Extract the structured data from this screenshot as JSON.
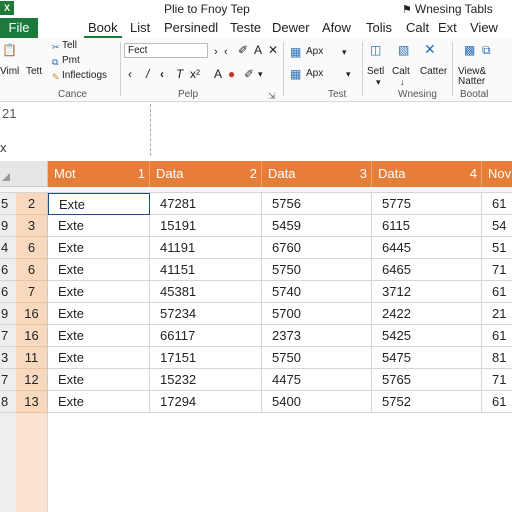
{
  "app": {
    "logo_text": "X",
    "title": "Plie to Fnoy Tep",
    "right_title": "Wnesing Tabls",
    "right_title_icon": "bell-icon"
  },
  "tabs": [
    "File",
    "Book",
    "List",
    "Persinedl",
    "Teste",
    "Dewer",
    "Afow",
    "Tolis",
    "Calt",
    "Ext",
    "View"
  ],
  "ribbon": {
    "clip_items": [
      "Tell",
      "Pmt",
      "Inflectiogs"
    ],
    "left_items": [
      "Viml",
      "Tett"
    ],
    "font_name": "Fect",
    "groups": [
      "Cance",
      "Pelp",
      "Test",
      "Wnesing",
      "Bootal"
    ],
    "style_labels": [
      "Apx",
      "Apx"
    ],
    "right_labels": [
      "Setl",
      "Calt",
      "Catter",
      "View&",
      "Natter"
    ]
  },
  "namebox": "21",
  "formula_prefix": "x",
  "columns": [
    {
      "num": "",
      "label": "Mot"
    },
    {
      "num": "1",
      "label": "Data"
    },
    {
      "num": "2",
      "label": "Data"
    },
    {
      "num": "3",
      "label": "Data"
    },
    {
      "num": "4",
      "label": "Nov"
    }
  ],
  "rows": [
    {
      "a": "5",
      "b": "2",
      "cells": [
        "Exte",
        "47281",
        "5756",
        "5775",
        "61"
      ]
    },
    {
      "a": "9",
      "b": "3",
      "cells": [
        "Exte",
        "15191",
        "5459",
        "6115",
        "54"
      ]
    },
    {
      "a": "4",
      "b": "6",
      "cells": [
        "Exte",
        "41191",
        "6760",
        "6445",
        "51"
      ]
    },
    {
      "a": "6",
      "b": "6",
      "cells": [
        "Exte",
        "41151",
        "5750",
        "6465",
        "71"
      ]
    },
    {
      "a": "6",
      "b": "7",
      "cells": [
        "Exte",
        "45381",
        "5740",
        "3712",
        "61"
      ]
    },
    {
      "a": "9",
      "b": "16",
      "cells": [
        "Exte",
        "57234",
        "5700",
        "2422",
        "21"
      ]
    },
    {
      "a": "7",
      "b": "16",
      "cells": [
        "Exte",
        "66117",
        "2373",
        "5425",
        "61"
      ]
    },
    {
      "a": "3",
      "b": "11",
      "cells": [
        "Exte",
        "17151",
        "5750",
        "5475",
        "81"
      ]
    },
    {
      "a": "7",
      "b": "12",
      "cells": [
        "Exte",
        "15232",
        "4475",
        "5765",
        "71"
      ]
    },
    {
      "a": "8",
      "b": "13",
      "cells": [
        "Exte",
        "17294",
        "5400",
        "5752",
        "61"
      ]
    }
  ],
  "colors": {
    "header_orange": "#e67e3a",
    "row_peach": "#f9d9bd",
    "file_green": "#1e7a3c"
  }
}
